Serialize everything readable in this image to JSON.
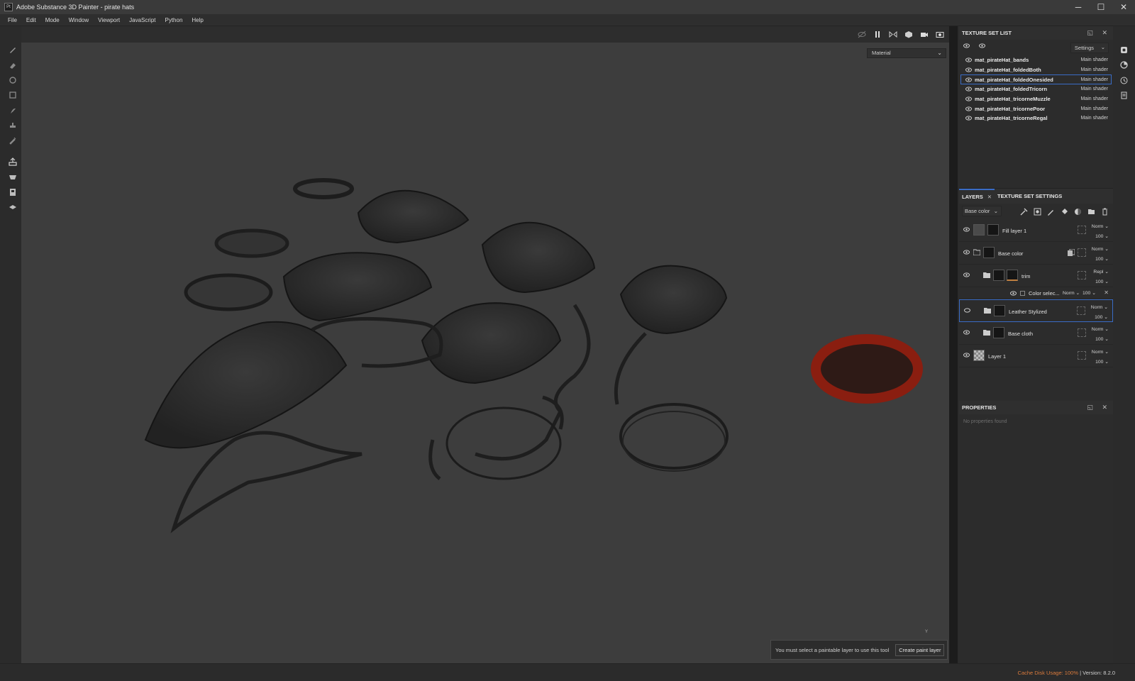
{
  "window": {
    "title": "Adobe Substance 3D Painter - pirate hats",
    "app_icon": "Pt"
  },
  "menu": [
    "File",
    "Edit",
    "Mode",
    "Window",
    "Viewport",
    "JavaScript",
    "Python",
    "Help"
  ],
  "left_tools": [
    "paint-brush-icon",
    "eraser-icon",
    "projection-icon",
    "geometry-mask-icon",
    "smudge-icon",
    "clone-icon",
    "color-picker-icon",
    "bake-icon",
    "export-icon",
    "shelf-icon",
    "layers-stack-icon"
  ],
  "viewport": {
    "display_mode": "Material",
    "tools": [
      "hide-overlay-icon",
      "pause-icon",
      "symmetry-icon",
      "cube-view-icon",
      "camera-icon",
      "screenshot-icon"
    ],
    "axis_label": "Y",
    "toast": {
      "message": "You must select a paintable layer to use this tool",
      "button": "Create paint layer"
    }
  },
  "texture_set_list": {
    "title": "TEXTURE SET LIST",
    "settings_label": "Settings",
    "items": [
      {
        "name": "mat_pirateHat_bands",
        "shader": "Main shader",
        "selected": false
      },
      {
        "name": "mat_pirateHat_foldedBoth",
        "shader": "Main shader",
        "selected": false
      },
      {
        "name": "mat_pirateHat_foldedOnesided",
        "shader": "Main shader",
        "selected": true
      },
      {
        "name": "mat_pirateHat_foldedTricorn",
        "shader": "Main shader",
        "selected": false
      },
      {
        "name": "mat_pirateHat_tricorneMuzzle",
        "shader": "Main shader",
        "selected": false
      },
      {
        "name": "mat_pirateHat_tricornePoor",
        "shader": "Main shader",
        "selected": false
      },
      {
        "name": "mat_pirateHat_tricorneRegal",
        "shader": "Main shader",
        "selected": false
      }
    ]
  },
  "layers": {
    "tabs": [
      {
        "label": "LAYERS",
        "close": "✕"
      },
      {
        "label": "TEXTURE SET SETTINGS"
      }
    ],
    "channel": "Base color",
    "items": [
      {
        "name": "Fill layer 1",
        "blend": "Norm",
        "opacity": "100"
      },
      {
        "name": "Base color",
        "blend": "Norm",
        "opacity": "100"
      },
      {
        "name": "trim",
        "blend": "Repl",
        "opacity": "100"
      },
      {
        "name": "Color selec...",
        "blend": "Norm",
        "opacity": "100"
      },
      {
        "name": "Leather Stylized",
        "blend": "Norm",
        "opacity": "100"
      },
      {
        "name": "Base cloth",
        "blend": "Norm",
        "opacity": "100"
      },
      {
        "name": "Layer 1",
        "blend": "Norm",
        "opacity": "100"
      }
    ]
  },
  "properties": {
    "title": "PROPERTIES",
    "empty_text": "No properties found"
  },
  "status": {
    "cache": "Cache Disk Usage: 100%",
    "version": "| Version: 8.2.0"
  },
  "colors": {
    "accent": "#3a6cc6",
    "warning": "#d97a3c",
    "viewport_bg": "#3d3d3d",
    "highlight_mesh": "#8a1e10"
  }
}
